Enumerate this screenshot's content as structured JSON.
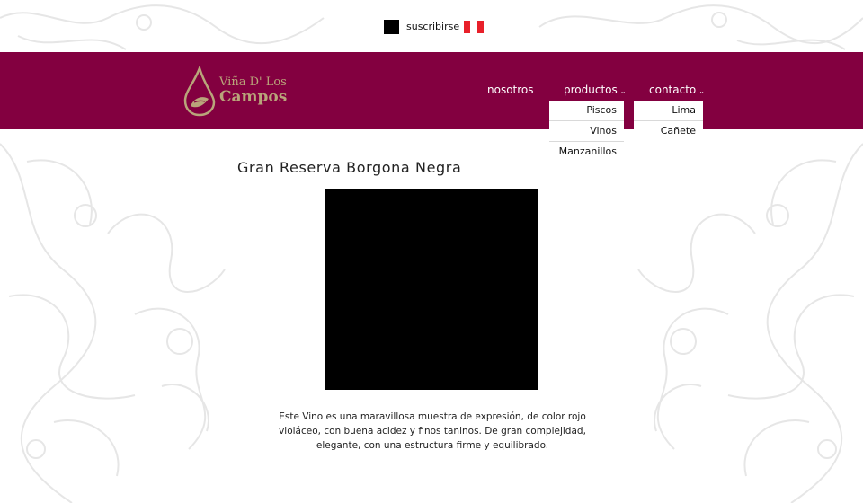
{
  "topbar": {
    "subscribe_label": "suscribirse",
    "flag_colors": [
      "#e8202a",
      "#ffffff",
      "#e8202a"
    ]
  },
  "brand": {
    "name_top": "Viña D' Los",
    "name_bottom": "Campos",
    "color": "#b9a57a"
  },
  "header": {
    "background": "#830040"
  },
  "nav": {
    "items": [
      {
        "label": "nosotros"
      },
      {
        "label": "productos",
        "submenu": [
          "Piscos",
          "Vinos",
          "Manzanillos"
        ]
      },
      {
        "label": "contacto",
        "submenu": [
          "Lima",
          "Cañete"
        ]
      }
    ]
  },
  "product": {
    "title": "Gran Reserva Borgona Negra",
    "description": "Este Vino es una maravillosa muestra de expresión, de color rojo violáceo, con buena acidez y finos taninos. De gran complejidad, elegante, con una estructura firme y equilibrado."
  }
}
